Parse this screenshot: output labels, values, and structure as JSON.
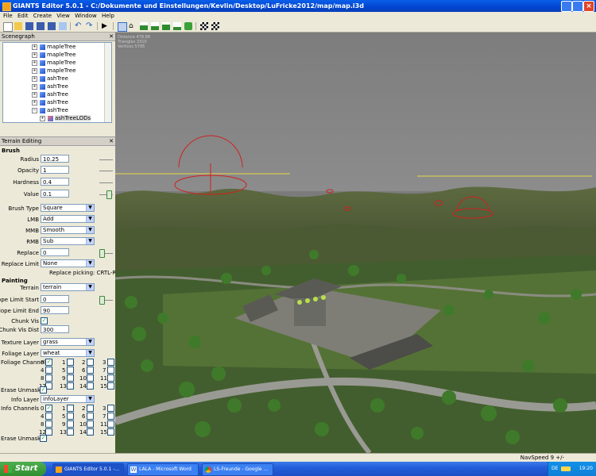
{
  "window": {
    "title": "GIANTS Editor 5.0.1 - C:/Dokumente und Einstellungen/Kevlin/Desktop/LuFricke2012/map/map.i3d"
  },
  "menu": [
    "File",
    "Edit",
    "Create",
    "View",
    "Window",
    "Help"
  ],
  "toolbar_icons": [
    "new-icon",
    "open-icon",
    "save-icon",
    "save-as-icon",
    "save-all-icon",
    "import-icon",
    "undo-icon",
    "redo-icon",
    "play-icon",
    "select-icon",
    "move-icon",
    "terrain-sculpt-icon",
    "terrain-smooth-icon",
    "terrain-paint-icon",
    "foliage-icon",
    "snap-icon",
    "settings-icon"
  ],
  "scenegraph": {
    "title": "Scenegraph",
    "items": [
      "mapleTree",
      "mapleTree",
      "mapleTree",
      "mapleTree",
      "ashTree",
      "ashTree",
      "ashTree",
      "ashTree",
      "ashTree",
      "ashTreeLODs"
    ]
  },
  "terrain": {
    "title": "Terrain Editing",
    "brush_section": "Brush",
    "radius_label": "Radius",
    "radius": "10.25",
    "opacity_label": "Opacity",
    "opacity": "1",
    "hardness_label": "Hardness",
    "hardness": "0.4",
    "value_label": "Value",
    "value": "0.1",
    "brush_type_label": "Brush Type",
    "brush_type": "Square",
    "lmb_label": "LMB",
    "lmb": "Add",
    "mmb_label": "MMB",
    "mmb": "Smooth",
    "rmb_label": "RMB",
    "rmb": "Sub",
    "replace_label": "Replace",
    "replace": "0",
    "replace_limit_label": "Replace Limit",
    "replace_limit": "None",
    "replace_hint": "Replace picking: CRTL-R",
    "painting_section": "Painting",
    "terrain_label": "Terrain",
    "terrain_value": "terrain",
    "slope_start_label": "Slope Limit Start",
    "slope_start": "0",
    "slope_end_label": "Slope Limit End",
    "slope_end": "90",
    "chunk_vis_label": "Chunk Vis",
    "chunk_vis_dist_label": "Chunk Vis Dist",
    "chunk_vis_dist": "300",
    "texture_layer_label": "Texture Layer",
    "texture_layer": "grass",
    "foliage_layer_label": "Foliage Layer",
    "foliage_layer": "wheat",
    "foliage_channels_label": "Foliage Channels",
    "erase_unmasked_label": "Erase Unmasked",
    "info_layer_label": "Info Layer",
    "info_layer": "infoLayer",
    "info_channels_label": "Info Channels",
    "erase_unmasked2_label": "Erase Unmasked",
    "channel_numbers": [
      "0",
      "1",
      "2",
      "3",
      "4",
      "5",
      "6",
      "7",
      "8",
      "9",
      "10",
      "11",
      "12",
      "13",
      "14",
      "15"
    ]
  },
  "viewport": {
    "stats": [
      "Distance 478.88",
      "Triangles 3310",
      "Vertices 5795"
    ]
  },
  "status": {
    "navspeed": "NavSpeed 9 +/-"
  },
  "taskbar": {
    "start": "Start",
    "tasks": [
      "GIANTS Editor 5.0.1 -...",
      "LALA - Microsoft Word",
      "LS-Freunde - Google ..."
    ],
    "lang": "DE",
    "clock": "19:20"
  }
}
